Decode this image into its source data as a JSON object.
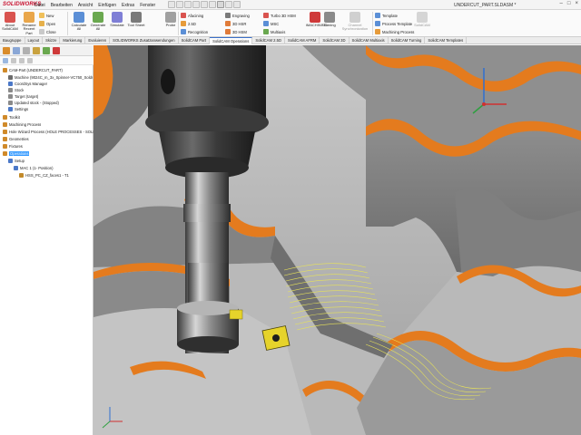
{
  "app": {
    "brand": "SOLIDWORKS",
    "menu": [
      "Datei",
      "Bearbeiten",
      "Ansicht",
      "Einfügen",
      "Extras",
      "Fenster"
    ],
    "document_title": "UNDERCUT_PART.SLDASM *"
  },
  "ribbon": {
    "about": "About SolidCAM",
    "rename": "Rename Recent Part",
    "new": "New",
    "open": "Open",
    "close": "Close",
    "calculate_all": "Calculate All",
    "generate_all": "Generate All",
    "simulate": "Simulate",
    "tool_sheet": "Tool Sheet",
    "probe": "Probe",
    "afacining": "Afacining",
    "d25": "2.5D",
    "recognition": "Recognition",
    "engraving": "Engraving",
    "hsr3d": "3D HSR",
    "hsm3d": "3D HSM",
    "turbo3d": "Turbo 3D HSM",
    "msc": "MSC",
    "multiaxis": "Multiaxis",
    "imachining": "iMACHINING",
    "turning": "Turning",
    "channel_sync": "Channel Synchronization",
    "template": "Template",
    "process_template": "Process Template",
    "machining_process": "Machining Process",
    "solidcam": "SolidCAM"
  },
  "tabs": [
    {
      "label": "Baugruppe",
      "active": false
    },
    {
      "label": "Layout",
      "active": false
    },
    {
      "label": "Skizze",
      "active": false
    },
    {
      "label": "Markierung",
      "active": false
    },
    {
      "label": "Evaluieren",
      "active": false
    },
    {
      "label": "SOLIDWORKS Zusatzanwendungen",
      "active": false
    },
    {
      "label": "SolidCAM Part",
      "active": false
    },
    {
      "label": "SolidCAM Operations",
      "active": true
    },
    {
      "label": "SolidCAM 2.5D",
      "active": false
    },
    {
      "label": "SolidCAM AFRM",
      "active": false
    },
    {
      "label": "SolidCAM 3D",
      "active": false
    },
    {
      "label": "SolidCAM Multiaxis",
      "active": false
    },
    {
      "label": "SolidCAM Turning",
      "active": false
    },
    {
      "label": "SolidCAM Templates",
      "active": false
    }
  ],
  "tree": [
    {
      "label": "CAM-Part (UNDERCUT_PART)",
      "indent": 0,
      "selected": false,
      "icon_color": "#d08a2a"
    },
    {
      "label": "Machine (9024C_m_3x_Spinner-VC750_Soldr",
      "indent": 1,
      "selected": false,
      "icon_color": "#6b6b6b"
    },
    {
      "label": "CoordSys Manager",
      "indent": 1,
      "selected": false,
      "icon_color": "#4b78c8"
    },
    {
      "label": "Stock",
      "indent": 1,
      "selected": false,
      "icon_color": "#8a8a8a"
    },
    {
      "label": "Target (target)",
      "indent": 1,
      "selected": false,
      "icon_color": "#8a8a8a"
    },
    {
      "label": "Updated stock - (Stopped)",
      "indent": 1,
      "selected": false,
      "icon_color": "#8a8a8a"
    },
    {
      "label": "Settings",
      "indent": 1,
      "selected": false,
      "icon_color": "#4b78c8"
    },
    {
      "label": "Toolkit",
      "indent": 0,
      "selected": false,
      "icon_color": "#d08a2a"
    },
    {
      "label": "Machining Process",
      "indent": 0,
      "selected": false,
      "icon_color": "#d08a2a"
    },
    {
      "label": "Hole Wizard Process (HOLE PROCESSES - SOLIDV",
      "indent": 0,
      "selected": false,
      "icon_color": "#d08a2a"
    },
    {
      "label": "Geometries",
      "indent": 0,
      "selected": false,
      "icon_color": "#d08a2a"
    },
    {
      "label": "Fixtures",
      "indent": 0,
      "selected": false,
      "icon_color": "#d08a2a"
    },
    {
      "label": "Operations",
      "indent": 0,
      "selected": true,
      "icon_color": "#d08a2a"
    },
    {
      "label": "Setup",
      "indent": 1,
      "selected": false,
      "icon_color": "#4b78c8"
    },
    {
      "label": "MAC 1 (1- Position)",
      "indent": 2,
      "selected": false,
      "icon_color": "#4b78c8"
    },
    {
      "label": "HSS_PC_CZ_faces1 - T1",
      "indent": 3,
      "selected": false,
      "icon_color": "#c28a2a"
    }
  ]
}
